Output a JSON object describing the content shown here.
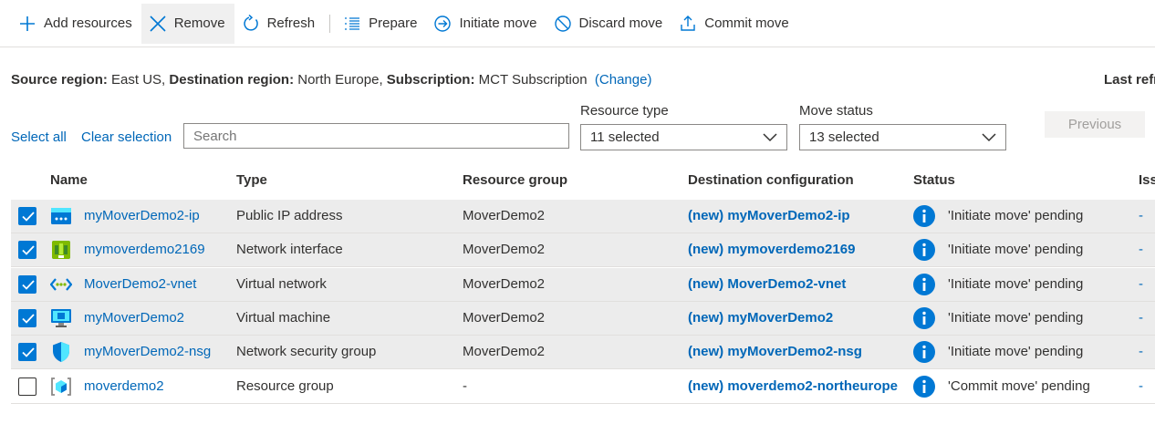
{
  "toolbar": {
    "add_resources": "Add resources",
    "remove": "Remove",
    "refresh": "Refresh",
    "prepare": "Prepare",
    "initiate_move": "Initiate move",
    "discard_move": "Discard move",
    "commit_move": "Commit move"
  },
  "region": {
    "source_label": "Source region:",
    "source_value": "East US,",
    "dest_label": "Destination region:",
    "dest_value": "North Europe,",
    "sub_label": "Subscription:",
    "sub_value": "MCT Subscription",
    "change": "(Change)",
    "last_refresh": "Last refr"
  },
  "filters": {
    "select_all": "Select all",
    "clear_selection": "Clear selection",
    "search_placeholder": "Search",
    "resource_type_label": "Resource type",
    "resource_type_value": "11 selected",
    "move_status_label": "Move status",
    "move_status_value": "13 selected",
    "previous": "Previous"
  },
  "table": {
    "headers": {
      "name": "Name",
      "type": "Type",
      "resource_group": "Resource group",
      "destination": "Destination configuration",
      "status": "Status",
      "issues": "Iss"
    },
    "rows": [
      {
        "name": "myMoverDemo2-ip",
        "type": "Public IP address",
        "group": "MoverDemo2",
        "dest": "(new) myMoverDemo2-ip",
        "status": "'Initiate move' pending",
        "issues": "-",
        "checked": true,
        "icon": "public-ip-icon"
      },
      {
        "name": "mymoverdemo2169",
        "type": "Network interface",
        "group": "MoverDemo2",
        "dest": "(new) mymoverdemo2169",
        "status": "'Initiate move' pending",
        "issues": "-",
        "checked": true,
        "icon": "network-interface-icon"
      },
      {
        "name": "MoverDemo2-vnet",
        "type": "Virtual network",
        "group": "MoverDemo2",
        "dest": "(new) MoverDemo2-vnet",
        "status": "'Initiate move' pending",
        "issues": "-",
        "checked": true,
        "icon": "virtual-network-icon"
      },
      {
        "name": "myMoverDemo2",
        "type": "Virtual machine",
        "group": "MoverDemo2",
        "dest": "(new) myMoverDemo2",
        "status": "'Initiate move' pending",
        "issues": "-",
        "checked": true,
        "icon": "virtual-machine-icon"
      },
      {
        "name": "myMoverDemo2-nsg",
        "type": "Network security group",
        "group": "MoverDemo2",
        "dest": "(new) myMoverDemo2-nsg",
        "status": "'Initiate move' pending",
        "issues": "-",
        "checked": true,
        "icon": "network-security-group-icon"
      },
      {
        "name": "moverdemo2",
        "type": "Resource group",
        "group": "-",
        "dest": "(new) moverdemo2-northeurope",
        "status": "'Commit move' pending",
        "issues": "-",
        "checked": false,
        "icon": "resource-group-icon"
      }
    ]
  },
  "colors": {
    "accent": "#0078d4",
    "link": "#0067b8",
    "selected_row": "#ececec"
  }
}
